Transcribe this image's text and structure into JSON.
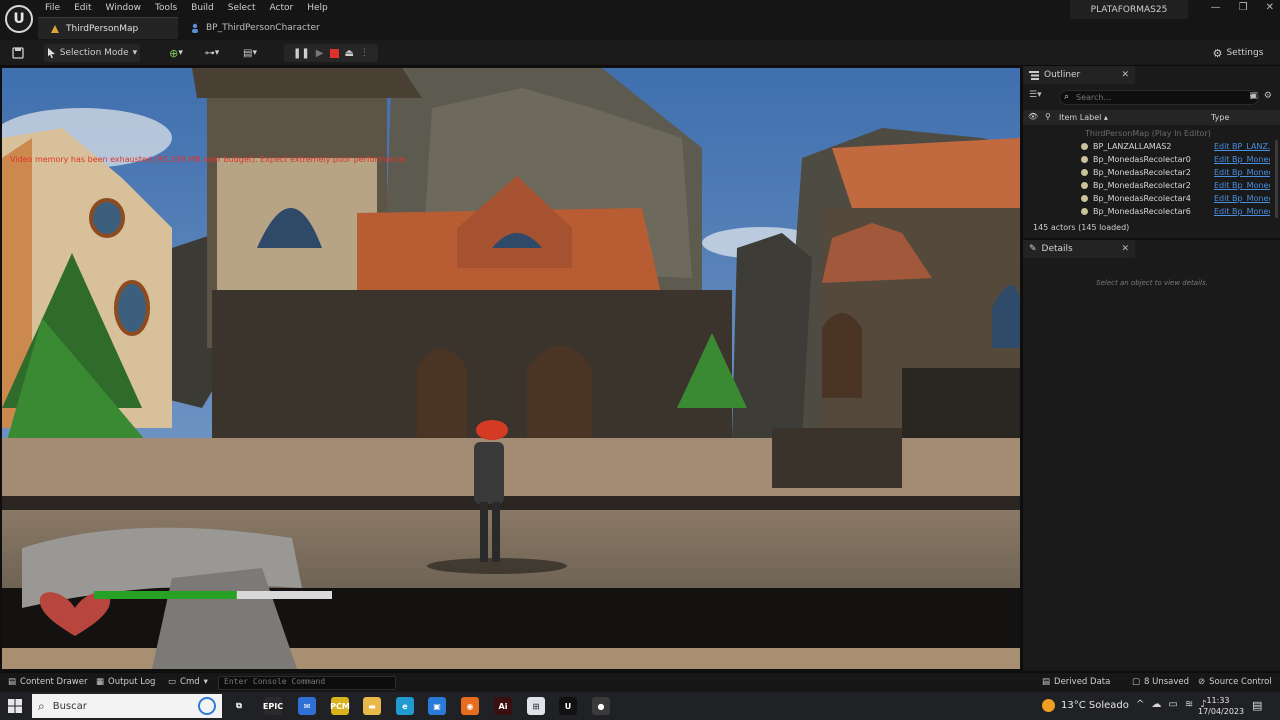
{
  "app": {
    "logo_letter": "U",
    "menu": [
      "File",
      "Edit",
      "Window",
      "Tools",
      "Build",
      "Select",
      "Actor",
      "Help"
    ],
    "tabs": [
      {
        "label": "ThirdPersonMap",
        "active": true
      },
      {
        "label": "BP_ThirdPersonCharacter",
        "active": false
      }
    ],
    "project_name": "PLATAFORMAS25",
    "window_controls": [
      "—",
      "❐",
      "✕"
    ]
  },
  "toolbar": {
    "selection_mode": "Selection Mode",
    "settings": "Settings"
  },
  "viewport": {
    "warning": "Video memory has been exhausted (95.339 MB over budget). Expect extremely poor performance.",
    "health_fraction": 0.6
  },
  "outliner": {
    "tab_label": "Outliner",
    "search_placeholder": "Search...",
    "col_label": "Item Label ▴",
    "col_type": "Type",
    "group_row": "ThirdPersonMap (Play In Editor)",
    "rows": [
      {
        "label": "BP_LANZALLAMAS2",
        "type": "Edit BP_LANZ..."
      },
      {
        "label": "Bp_MonedasRecolectar0",
        "type": "Edit Bp_Monec..."
      },
      {
        "label": "Bp_MonedasRecolectar2",
        "type": "Edit Bp_Monec..."
      },
      {
        "label": "Bp_MonedasRecolectar2",
        "type": "Edit Bp_Monec..."
      },
      {
        "label": "Bp_MonedasRecolectar4",
        "type": "Edit Bp_Monec..."
      },
      {
        "label": "Bp_MonedasRecolectar6",
        "type": "Edit Bp_Monec..."
      }
    ],
    "actor_count": "145 actors (145 loaded)"
  },
  "details": {
    "tab_label": "Details",
    "empty_text": "Select an object to view details."
  },
  "statusbar": {
    "content_drawer": "Content Drawer",
    "output_log": "Output Log",
    "cmd": "Cmd",
    "console_placeholder": "Enter Console Command",
    "derived_data": "Derived Data",
    "unsaved": "8 Unsaved",
    "source_control": "Source Control"
  },
  "taskbar": {
    "search": "Buscar",
    "apps": [
      {
        "name": "task-view",
        "label": "⧉",
        "color": "#202124"
      },
      {
        "name": "epic-games",
        "label": "EPIC",
        "color": "#2a2a2a"
      },
      {
        "name": "mail",
        "label": "✉",
        "color": "#2f6fd6"
      },
      {
        "name": "pcm",
        "label": "PCM",
        "color": "#d9b21e"
      },
      {
        "name": "file-explorer",
        "label": "▬",
        "color": "#e8b84a"
      },
      {
        "name": "edge",
        "label": "e",
        "color": "#1f9bd1"
      },
      {
        "name": "store",
        "label": "▣",
        "color": "#2a7bd8"
      },
      {
        "name": "firefox",
        "label": "◉",
        "color": "#e66d1f"
      },
      {
        "name": "illustrator",
        "label": "Ai",
        "color": "#3a0f0f"
      },
      {
        "name": "ms-store",
        "label": "⊞",
        "color": "#dfe3e8"
      },
      {
        "name": "unreal",
        "label": "U",
        "color": "#111111"
      },
      {
        "name": "recorder",
        "label": "●",
        "color": "#3a3a3a"
      }
    ],
    "weather": "13°C  Soleado",
    "time": "11:33",
    "date": "17/04/2023"
  }
}
